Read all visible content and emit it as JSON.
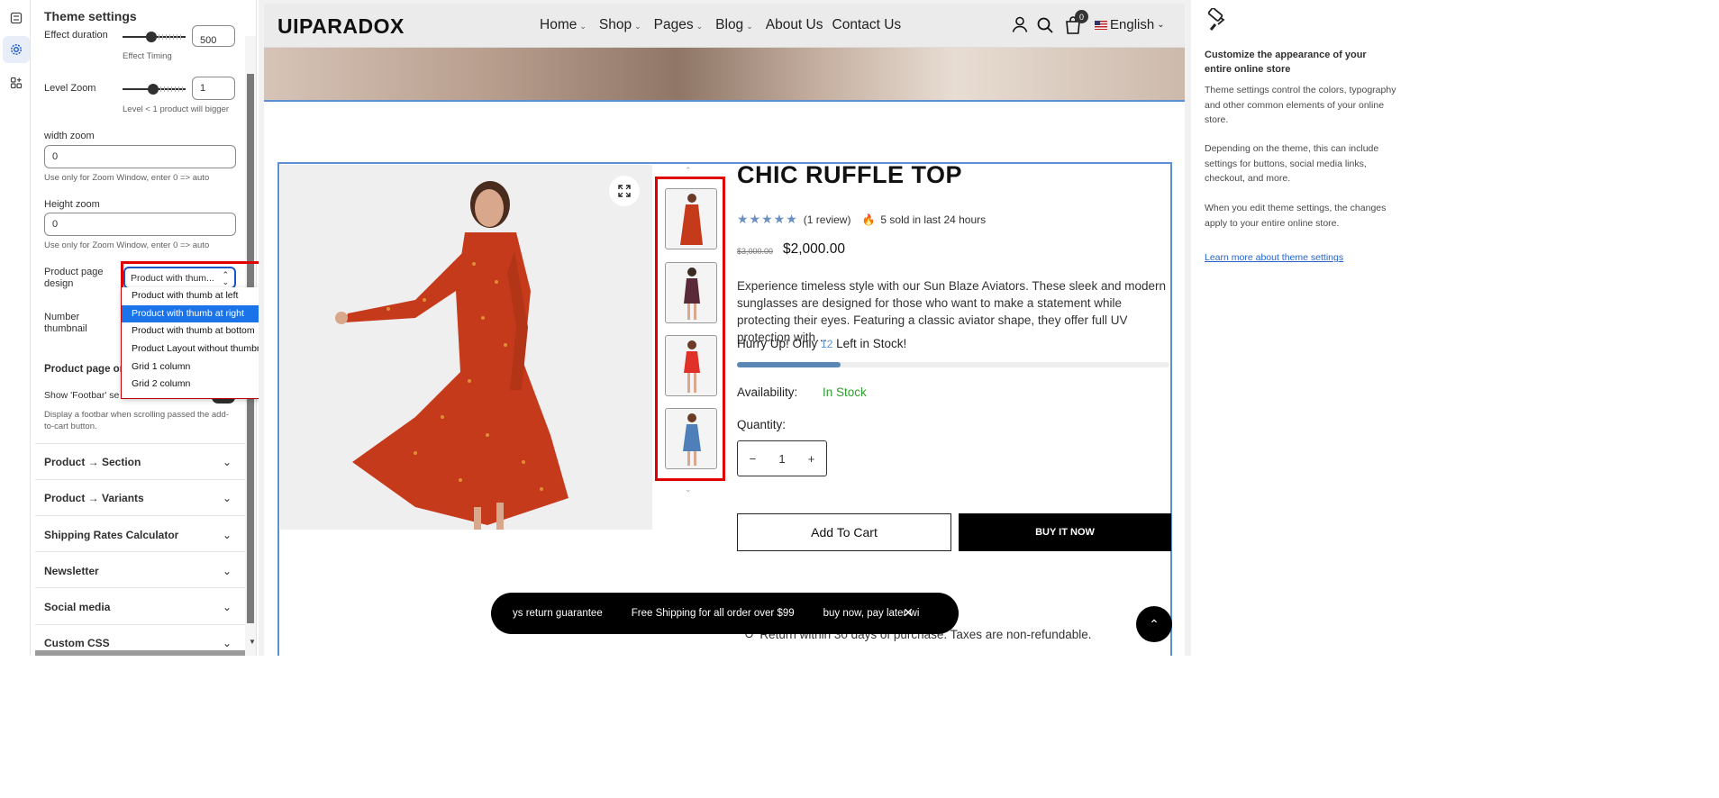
{
  "rail": {
    "icons": [
      "sections-icon",
      "theme-settings-icon",
      "apps-icon"
    ]
  },
  "panel": {
    "title": "Theme settings",
    "effect_duration": {
      "label": "Effect duration",
      "value": "500",
      "help": "Effect Timing"
    },
    "level_zoom": {
      "label": "Level Zoom",
      "value": "1",
      "help": "Level < 1 product will bigger"
    },
    "width_zoom": {
      "label": "width zoom",
      "value": "0",
      "help": "Use only for Zoom Window, enter 0 => auto"
    },
    "height_zoom": {
      "label": "Height zoom",
      "value": "0",
      "help": "Use only for Zoom Window, enter 0 => auto"
    },
    "product_page_design": {
      "label": "Product page design",
      "selected": "Product with thum...",
      "options": [
        "Product with thumb at left",
        "Product with thumb at right",
        "Product with thumb at bottom",
        "Product Layout without thumbnail",
        "Grid 1 column",
        "Grid 2 column"
      ]
    },
    "number_thumbnail": {
      "label": "Number thumbnail"
    },
    "product_page_on": {
      "label": "Product page on",
      "footbar_label": "Show 'Footbar' se",
      "footbar_help": "Display a footbar when scrolling passed the add-to-cart button."
    },
    "sections": [
      "Product → Section",
      "Product → Variants",
      "Shipping Rates Calculator",
      "Newsletter",
      "Social media",
      "Custom CSS"
    ]
  },
  "site": {
    "logo": "UIPARADOX",
    "nav": [
      {
        "label": "Home",
        "dropdown": true
      },
      {
        "label": "Shop",
        "dropdown": true
      },
      {
        "label": "Pages",
        "dropdown": true
      },
      {
        "label": "Blog",
        "dropdown": true
      },
      {
        "label": "About Us",
        "dropdown": false
      },
      {
        "label": "Contact Us",
        "dropdown": false
      }
    ],
    "cart_count": "0",
    "language": "English",
    "product": {
      "title": "CHIC RUFFLE TOP",
      "stars": "★★★★★",
      "reviews": "(1 review)",
      "sold": "5 sold in last 24 hours",
      "old_price": "$3,000.00",
      "price": "$2,000.00",
      "description": "Experience timeless style with our Sun Blaze Aviators. These sleek and modern sunglasses are designed for those who want to make a statement while protecting their eyes. Featuring a classic aviator shape, they offer full UV protection with…",
      "hurry_prefix": "Hurry Up! Only",
      "stock_count": "12",
      "hurry_suffix": "Left in Stock!",
      "stock_progress": 0.24,
      "availability_label": "Availability:",
      "availability_value": "In Stock",
      "quantity_label": "Quantity:",
      "quantity": "1",
      "add_to_cart": "Add To Cart",
      "buy_now": "BUY IT NOW",
      "returns": "Return within 30 days of purchase. Taxes are non-refundable."
    },
    "ticker": [
      "ys return guarantee",
      "Free Shipping for all order over $99",
      "buy now, pay later wi"
    ]
  },
  "help": {
    "heading": "Customize the appearance of your entire online store",
    "p1": "Theme settings control the colors, typography and other common elements of your online store.",
    "p2": "Depending on the theme, this can include settings for buttons, social media links, checkout, and more.",
    "p3": "When you edit theme settings, the changes apply to your entire online store.",
    "link": "Learn more about theme settings"
  },
  "colors": {
    "accent": "#1a73e8",
    "highlight": "#e00000",
    "in_stock": "#2e9e2e",
    "frame": "#5b8fd6"
  }
}
